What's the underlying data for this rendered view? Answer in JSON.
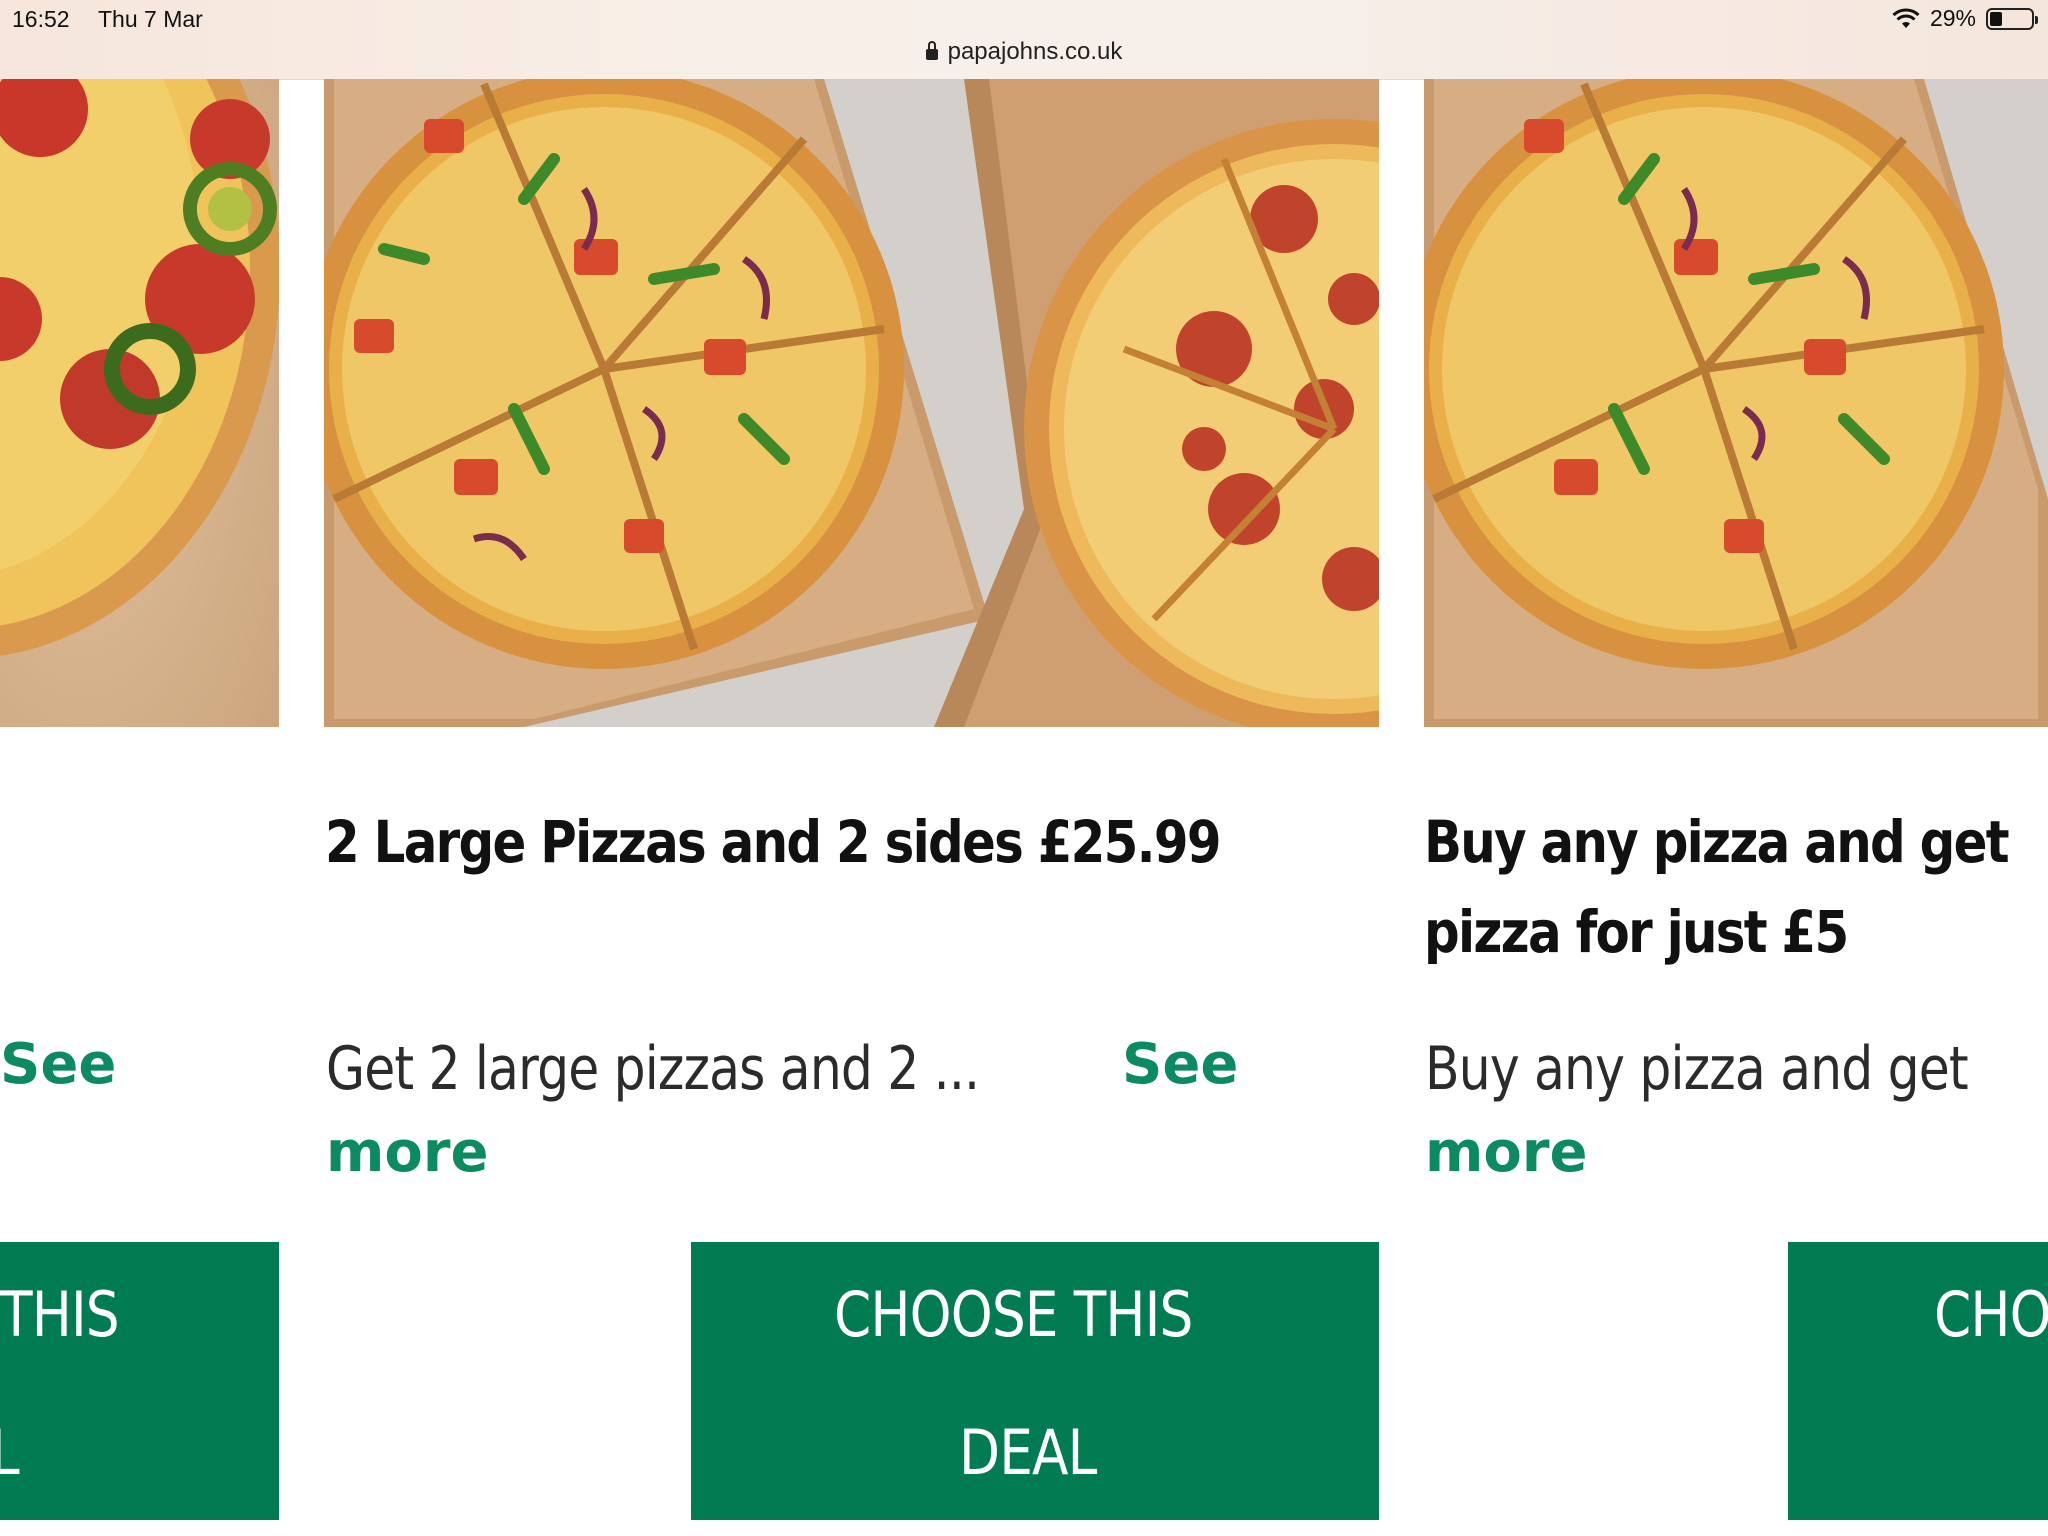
{
  "status_bar": {
    "time": "16:52",
    "date": "Thu 7 Mar",
    "battery": "29%",
    "battery_level": 0.29
  },
  "address_bar": {
    "url": "papajohns.co.uk"
  },
  "colors": {
    "accent_green": "#017b51",
    "link_green": "#0c8a62"
  },
  "deals": [
    {
      "title": "",
      "description": "",
      "see_label": "See",
      "more_label": "",
      "button_line1": "THIS",
      "button_line2": "L"
    },
    {
      "title": "2 Large Pizzas and 2 sides £25.99",
      "description": "Get 2 large pizzas and 2 ...",
      "see_label": "See",
      "more_label": "more",
      "button_line1": "CHOOSE THIS",
      "button_line2": "DEAL"
    },
    {
      "title_line1": "Buy any pizza and get",
      "title_line2": "pizza for just £5",
      "description": "Buy any pizza and get",
      "more_label": "more",
      "button_line1": "CHO"
    }
  ]
}
